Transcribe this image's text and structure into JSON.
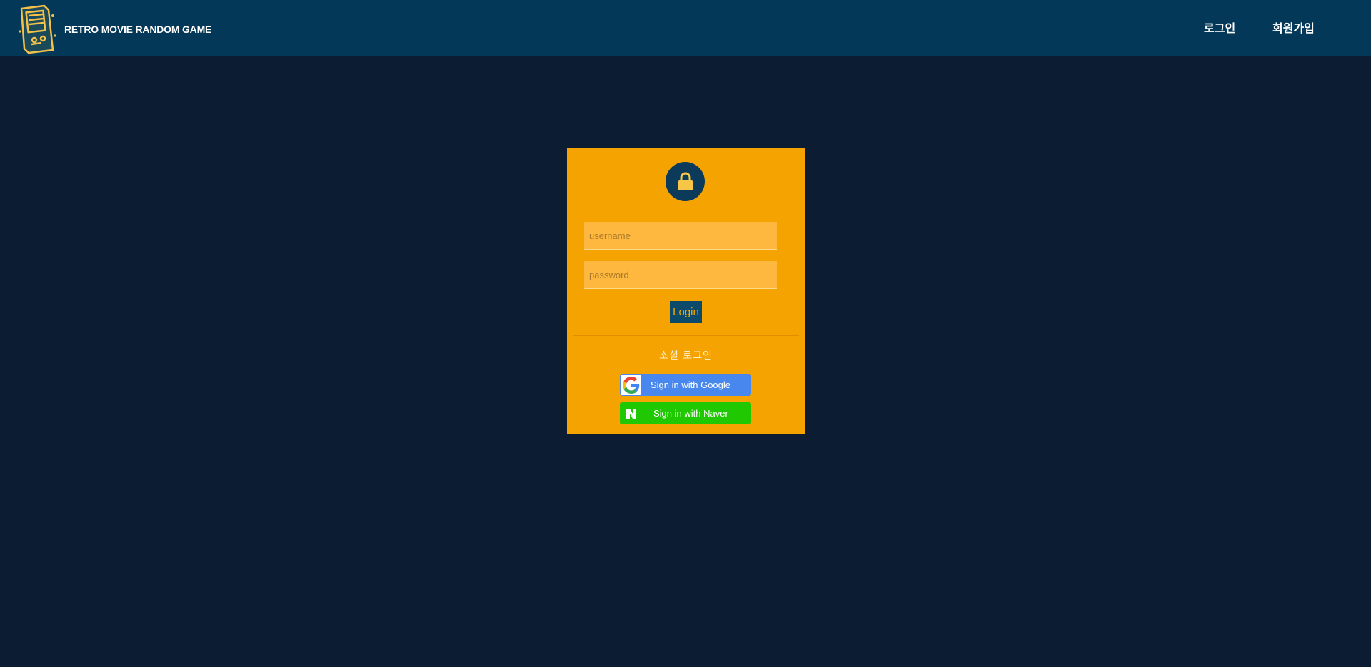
{
  "header": {
    "brand_title": "RETRO MOVIE RANDOM GAME",
    "logo_icon": "retro-arcade-machine-icon",
    "nav": {
      "login": "로그인",
      "signup": "회원가입"
    }
  },
  "login_card": {
    "lock_icon": "lock-icon",
    "username_placeholder": "username",
    "password_placeholder": "password",
    "login_button": "Login",
    "social_title": "소셜 로그인",
    "google_button": "Sign in with Google",
    "naver_button": "Sign in with Naver"
  },
  "colors": {
    "page_background": "#0c1d33",
    "navbar_background": "#043858",
    "card_background": "#f4a300",
    "input_background": "#ffb83f",
    "login_button_background": "#0b4a6a",
    "google_blue": "#4787ee",
    "naver_green": "#1fc800"
  }
}
